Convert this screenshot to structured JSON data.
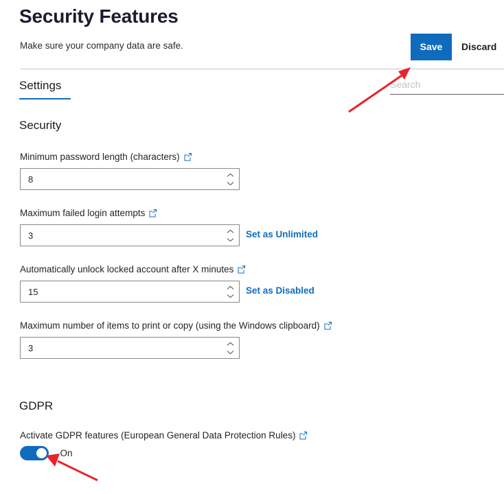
{
  "header": {
    "title": "Security Features",
    "subtitle": "Make sure your company data are safe.",
    "save_label": "Save",
    "discard_label": "Discard"
  },
  "tabs": [
    {
      "label": "Settings",
      "active": true
    }
  ],
  "search": {
    "placeholder": "Search",
    "value": ""
  },
  "sections": [
    {
      "title": "Security",
      "fields": [
        {
          "label": "Minimum password length (characters)",
          "value": "8",
          "has_external_link": true,
          "side_link": ""
        },
        {
          "label": "Maximum failed login attempts",
          "value": "3",
          "has_external_link": true,
          "side_link": "Set as Unlimited"
        },
        {
          "label": "Automatically unlock locked account after X minutes",
          "value": "15",
          "has_external_link": true,
          "side_link": "Set as Disabled"
        },
        {
          "label": "Maximum number of items to print or copy (using the Windows clipboard)",
          "value": "3",
          "has_external_link": true,
          "side_link": ""
        }
      ]
    },
    {
      "title": "GDPR",
      "toggle": {
        "label": "Activate GDPR features (European General Data Protection Rules)",
        "state_label": "On",
        "checked": true,
        "has_external_link": true
      }
    }
  ],
  "icons": {
    "external_link": "external-link-icon",
    "spinner_up": "chevron-up-icon",
    "spinner_down": "chevron-down-icon"
  },
  "colors": {
    "accent": "#0f6cbd",
    "link": "#0f6cbd",
    "toggle_on": "#0f6cbd",
    "annotation_arrow": "#e8232a",
    "divider": "#c8c6c4",
    "input_border": "#8a8886"
  },
  "annotations": [
    {
      "name": "arrow-pointing-to-save-button"
    },
    {
      "name": "arrow-pointing-to-gdpr-toggle"
    }
  ]
}
